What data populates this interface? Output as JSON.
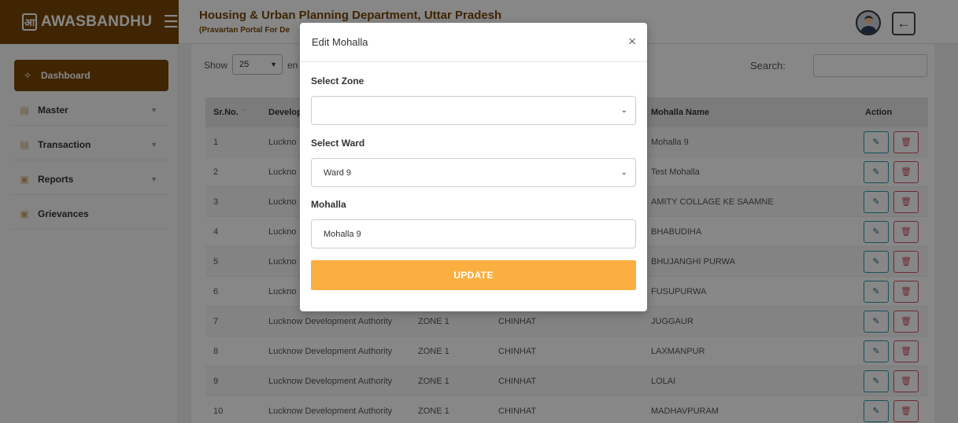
{
  "brand": {
    "logo_text": "आ",
    "name": "AWASBANDHU"
  },
  "header": {
    "title": "Housing & Urban Planning Department, Uttar Pradesh",
    "subtitle": "(Pravartan Portal For De"
  },
  "sidebar": {
    "items": [
      {
        "label": "Dashboard",
        "icon": "tag-icon"
      },
      {
        "label": "Master",
        "icon": "document-icon"
      },
      {
        "label": "Transaction",
        "icon": "document-icon"
      },
      {
        "label": "Reports",
        "icon": "folder-icon"
      },
      {
        "label": "Grievances",
        "icon": "folder-icon"
      }
    ]
  },
  "table_controls": {
    "show_label": "Show",
    "show_value": "25",
    "show_suffix": "en",
    "search_label": "Search:"
  },
  "table": {
    "headers": [
      "Sr.No.",
      "Develop",
      "",
      "",
      "Mohalla Name",
      "Action"
    ],
    "rows": [
      {
        "sr": "1",
        "authority": "Luckno",
        "zone": "",
        "ward": "",
        "mohalla": "Mohalla 9"
      },
      {
        "sr": "2",
        "authority": "Luckno",
        "zone": "",
        "ward": "",
        "mohalla": "Test Mohalla"
      },
      {
        "sr": "3",
        "authority": "Luckno",
        "zone": "",
        "ward": "",
        "mohalla": "AMITY COLLAGE KE SAAMNE"
      },
      {
        "sr": "4",
        "authority": "Luckno",
        "zone": "",
        "ward": "",
        "mohalla": "BHABUDIHA"
      },
      {
        "sr": "5",
        "authority": "Luckno",
        "zone": "",
        "ward": "",
        "mohalla": "BHUJANGHI PURWA"
      },
      {
        "sr": "6",
        "authority": "Luckno",
        "zone": "",
        "ward": "",
        "mohalla": "FUSUPURWA"
      },
      {
        "sr": "7",
        "authority": "Lucknow Development Authority",
        "zone": "ZONE 1",
        "ward": "CHINHAT",
        "mohalla": "JUGGAUR"
      },
      {
        "sr": "8",
        "authority": "Lucknow Development Authority",
        "zone": "ZONE 1",
        "ward": "CHINHAT",
        "mohalla": "LAXMANPUR"
      },
      {
        "sr": "9",
        "authority": "Lucknow Development Authority",
        "zone": "ZONE 1",
        "ward": "CHINHAT",
        "mohalla": "LOLAI"
      },
      {
        "sr": "10",
        "authority": "Lucknow Development Authority",
        "zone": "ZONE 1",
        "ward": "CHINHAT",
        "mohalla": "MADHAVPURAM"
      }
    ]
  },
  "modal": {
    "title": "Edit Mohalla",
    "close": "×",
    "zone_label": "Select Zone",
    "zone_value": "",
    "ward_label": "Select Ward",
    "ward_value": "Ward 9",
    "mohalla_label": "Mohalla",
    "mohalla_value": "Mohalla 9",
    "submit_label": "UPDATE"
  },
  "colors": {
    "brand": "#7a4707",
    "update_button": "#fbaf41",
    "edit_button_border": "#2a9bb0",
    "delete_button_border": "#d05060"
  }
}
